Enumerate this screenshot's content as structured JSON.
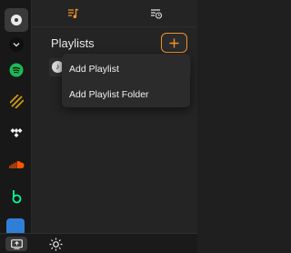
{
  "rail": {
    "items": [
      {
        "name": "library",
        "icon": "disc-icon",
        "active": true
      },
      {
        "name": "collapse",
        "icon": "chevron-down-icon"
      },
      {
        "name": "spotify",
        "icon": "spotify-icon",
        "color": "#1db954"
      },
      {
        "name": "deezer-like",
        "icon": "stripes-icon",
        "color": "#d8a21b"
      },
      {
        "name": "tidal",
        "icon": "tidal-icon"
      },
      {
        "name": "soundcloud",
        "icon": "soundcloud-icon",
        "color": "#ff5500"
      },
      {
        "name": "beatport",
        "icon": "beatport-icon",
        "color": "#01ff95"
      },
      {
        "name": "partial-blue",
        "icon": "app-icon",
        "color": "#2f7fd9"
      }
    ]
  },
  "tabs": [
    {
      "name": "queue-tab",
      "icon": "music-list-icon",
      "color": "#f0922a",
      "active": true
    },
    {
      "name": "history-tab",
      "icon": "list-clock-icon",
      "color": "#e0e0e0",
      "active": false
    }
  ],
  "panel": {
    "title": "Playlists",
    "add_button_icon": "plus-icon"
  },
  "menu": {
    "items": [
      "Add Playlist",
      "Add Playlist Folder"
    ]
  },
  "bottom": {
    "left_button_icon": "screen-upload-icon",
    "theme_icon": "sun-icon"
  },
  "colors": {
    "accent": "#f0922a",
    "background": "#242424",
    "rail": "#181818"
  }
}
